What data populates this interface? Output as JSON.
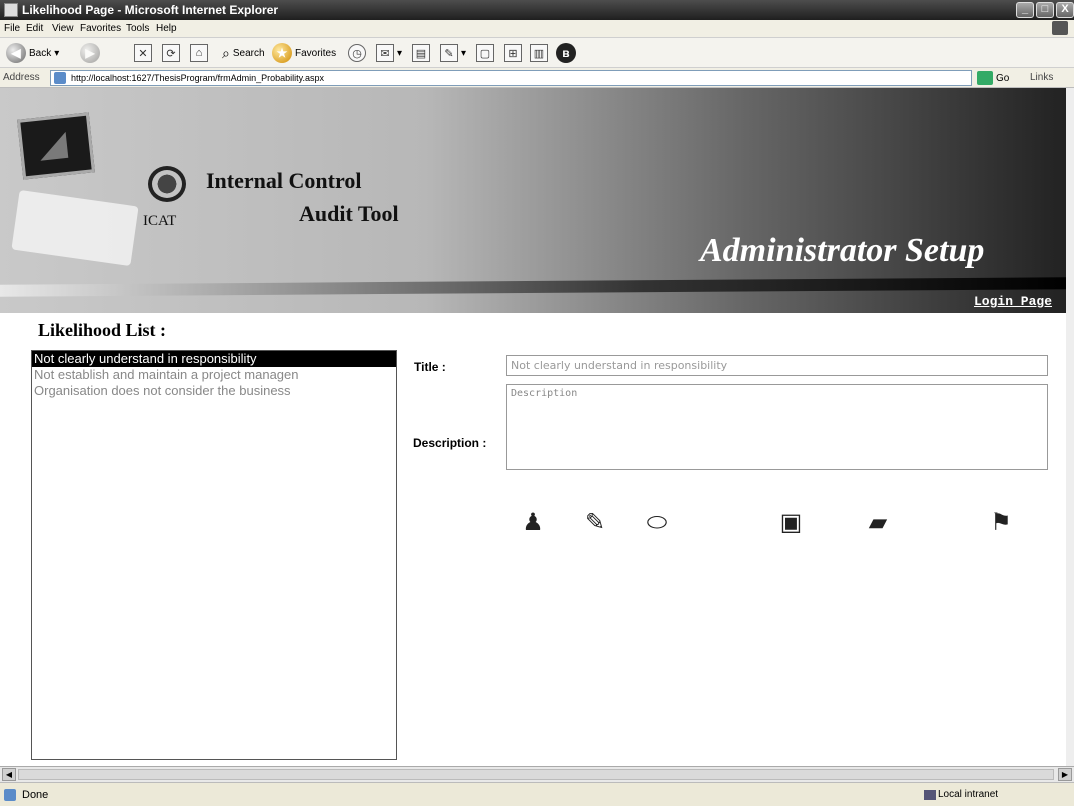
{
  "window": {
    "title": "Likelihood Page - Microsoft Internet Explorer",
    "min_glyph": "_",
    "max_glyph": "□",
    "close_glyph": "X"
  },
  "menu": [
    "File",
    "Edit",
    "View",
    "Favorites",
    "Tools",
    "Help"
  ],
  "toolbar": {
    "back_label": "Back",
    "search_label": "Search",
    "favorites_label": "Favorites"
  },
  "address": {
    "label": "Address",
    "url": "http://localhost:1627/ThesisProgram/frmAdmin_Probability.aspx",
    "go_label": "Go",
    "links_label": "Links"
  },
  "banner": {
    "logo_text": "ICAT",
    "app_name_line1": "Internal Control",
    "app_name_line2": "Audit Tool",
    "section_title": "Administrator Setup",
    "login_link": "Login Page"
  },
  "likelihood": {
    "list_title": "Likelihood List :",
    "items": [
      "Not clearly understand in responsibility",
      "Not establish and maintain a project managen",
      "Organisation does not consider the business"
    ],
    "selected_index": 0
  },
  "form": {
    "title_label": "Title :",
    "title_value": "Not clearly understand in responsibility",
    "description_label": "Description :",
    "description_value": "Description"
  },
  "actions": {
    "add_icon": "add-user-icon",
    "edit_icon": "pencil-icon",
    "delete_icon": "eraser-icon",
    "save_icon": "floppy-disk-icon",
    "cancel_icon": "cancel-stamp-icon",
    "exit_icon": "signpost-icon"
  },
  "status": {
    "text": "Done",
    "zone": "Local intranet"
  }
}
